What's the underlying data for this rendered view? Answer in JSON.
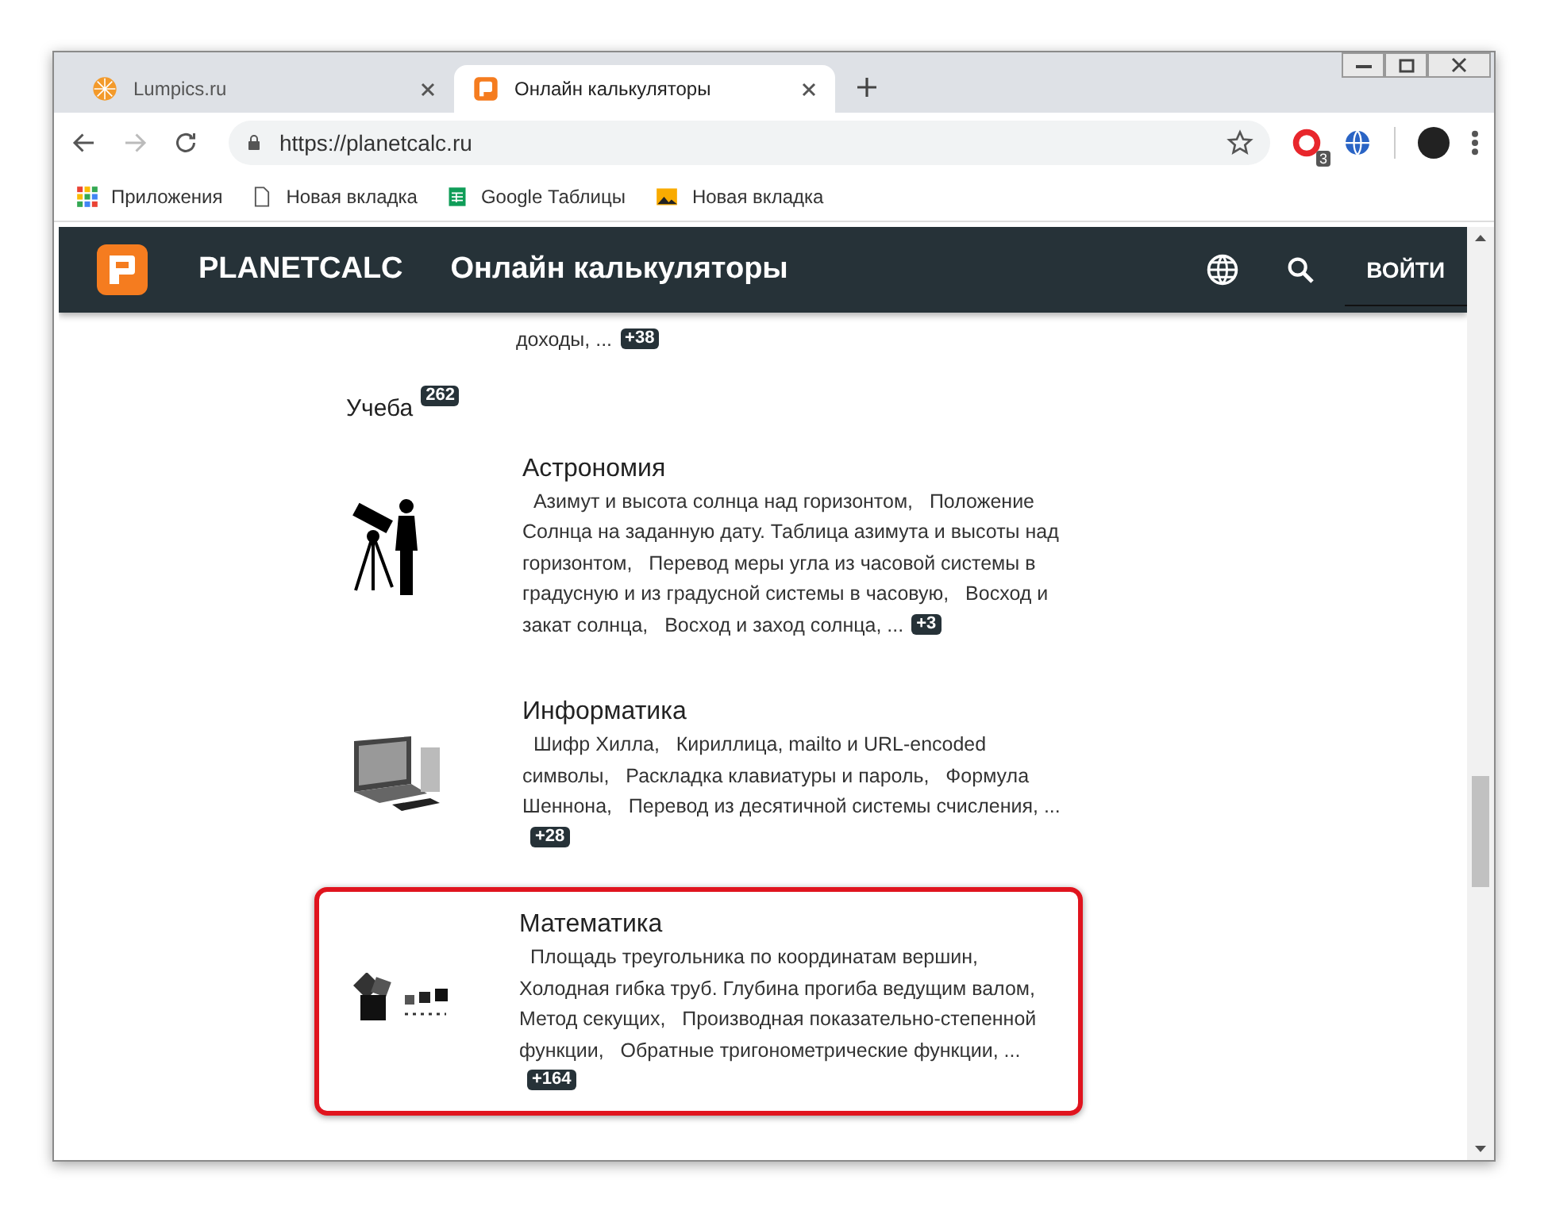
{
  "browser": {
    "tabs": [
      {
        "title": "Lumpics.ru",
        "kind": "orange",
        "selected": false
      },
      {
        "title": "Онлайн калькуляторы",
        "kind": "planetcalc",
        "selected": true
      }
    ],
    "url": "https://planetcalc.ru",
    "extension_badge": "3",
    "bookmarks": [
      {
        "label": "Приложения",
        "kind": "apps"
      },
      {
        "label": "Новая вкладка",
        "kind": "page"
      },
      {
        "label": "Google Таблицы",
        "kind": "sheets"
      },
      {
        "label": "Новая вкладка",
        "kind": "image"
      }
    ]
  },
  "header": {
    "brand": "PLANETCALC",
    "title": "Онлайн калькуляторы",
    "login": "ВОЙТИ"
  },
  "partial_item": {
    "description": "доходы, ...",
    "more": "+38"
  },
  "category": {
    "name": "Учеба",
    "count": "262"
  },
  "items": [
    {
      "title": "Астрономия",
      "kind": "astronomy",
      "highlighted": false,
      "description": "Азимут и высота солнца над горизонтом,   Положение Солнца на заданную дату. Таблица азимута и высоты над горизонтом,   Перевод меры угла из часовой системы в градусную и из градусной системы в часовую,   Восход и закат солнца,   Восход и заход солнца, ...",
      "more": "+3"
    },
    {
      "title": "Информатика",
      "kind": "computer",
      "highlighted": false,
      "description": "Шифр Хилла,   Кириллица, mailto и URL-encoded символы,   Раскладка клавиатуры и пароль,   Формула Шеннона,   Перевод из десятичной системы счисления, ...",
      "more": "+28"
    },
    {
      "title": "Математика",
      "kind": "math",
      "highlighted": true,
      "description": "Площадь треугольника по координатам вершин,   Холодная гибка труб. Глубина прогиба ведущим валом,   Метод секущих,   Производная показательно-степенной функции,   Обратные тригонометрические функции, ...",
      "more": "+164"
    }
  ]
}
